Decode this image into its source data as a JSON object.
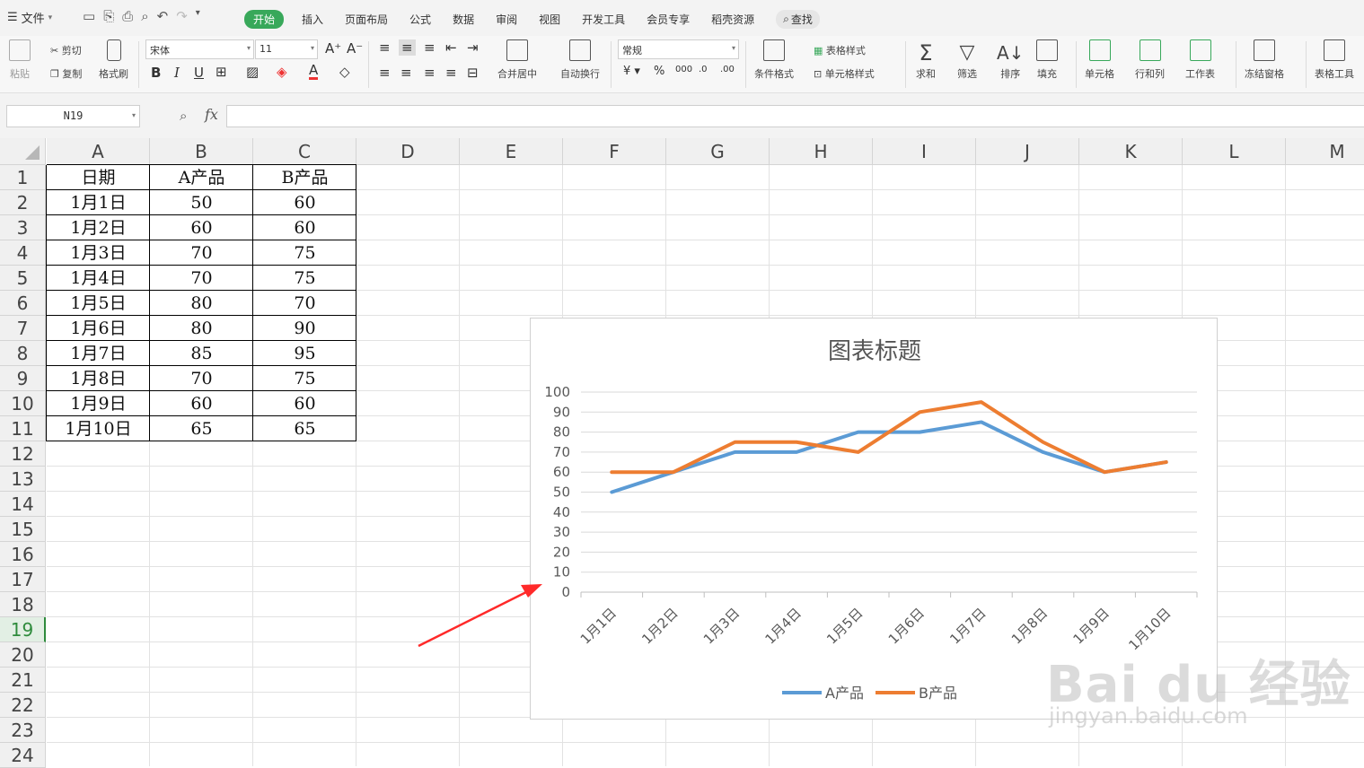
{
  "menu": {
    "file_label": "文件",
    "tabs": [
      "开始",
      "插入",
      "页面布局",
      "公式",
      "数据",
      "审阅",
      "视图",
      "开发工具",
      "会员专享",
      "稻壳资源"
    ],
    "active_tab": "开始",
    "search_label": "查找"
  },
  "ribbon": {
    "paste": "粘贴",
    "cut": "剪切",
    "copy": "复制",
    "format_painter": "格式刷",
    "font_name": "宋体",
    "font_size": "11",
    "merge_center": "合并居中",
    "wrap_text": "自动换行",
    "number_format": "常规",
    "conditional_format": "条件格式",
    "table_style": "表格样式",
    "cell_style": "单元格样式",
    "sum": "求和",
    "filter": "筛选",
    "sort": "排序",
    "fill": "填充",
    "cell": "单元格",
    "row_col": "行和列",
    "worksheet": "工作表",
    "freeze": "冻结窗格",
    "table_tools": "表格工具"
  },
  "formula_bar": {
    "name_box": "N19",
    "fx": "fx",
    "content": ""
  },
  "sheet": {
    "columns": [
      "A",
      "B",
      "C",
      "D",
      "E",
      "F",
      "G",
      "H",
      "I",
      "J",
      "K",
      "L",
      "M"
    ],
    "rows": [
      "1",
      "2",
      "3",
      "4",
      "5",
      "6",
      "7",
      "8",
      "9",
      "10",
      "11",
      "12",
      "13",
      "14",
      "15",
      "16",
      "17",
      "18",
      "19",
      "20",
      "21",
      "22",
      "23",
      "24"
    ],
    "selected_row": "19",
    "header": [
      "日期",
      "A产品",
      "B产品"
    ],
    "data": [
      [
        "1月1日",
        "50",
        "60"
      ],
      [
        "1月2日",
        "60",
        "60"
      ],
      [
        "1月3日",
        "70",
        "75"
      ],
      [
        "1月4日",
        "70",
        "75"
      ],
      [
        "1月5日",
        "80",
        "70"
      ],
      [
        "1月6日",
        "80",
        "90"
      ],
      [
        "1月7日",
        "85",
        "95"
      ],
      [
        "1月8日",
        "70",
        "75"
      ],
      [
        "1月9日",
        "60",
        "60"
      ],
      [
        "1月10日",
        "65",
        "65"
      ]
    ]
  },
  "chart_data": {
    "type": "line",
    "title": "图表标题",
    "categories": [
      "1月1日",
      "1月2日",
      "1月3日",
      "1月4日",
      "1月5日",
      "1月6日",
      "1月7日",
      "1月8日",
      "1月9日",
      "1月10日"
    ],
    "series": [
      {
        "name": "A产品",
        "values": [
          50,
          60,
          70,
          70,
          80,
          80,
          85,
          70,
          60,
          65
        ],
        "color": "#5b9bd5"
      },
      {
        "name": "B产品",
        "values": [
          60,
          60,
          75,
          75,
          70,
          90,
          95,
          75,
          60,
          65
        ],
        "color": "#ed7d31"
      }
    ],
    "ylim": [
      0,
      100
    ],
    "yticks": [
      0,
      10,
      20,
      30,
      40,
      50,
      60,
      70,
      80,
      90,
      100
    ],
    "grid": true,
    "legend": "bottom"
  },
  "watermark": {
    "main": "Bai du 经验",
    "sub": "jingyan.baidu.com"
  },
  "colors": {
    "accent": "#38a85a",
    "arrow": "#ff2a2a"
  }
}
